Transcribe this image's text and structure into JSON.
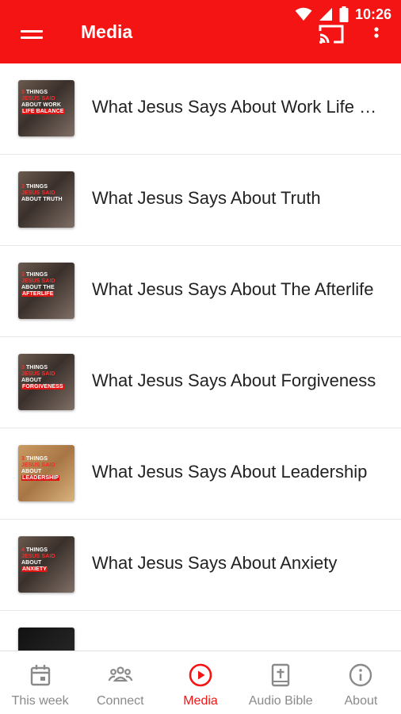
{
  "status_bar": {
    "time": "10:26"
  },
  "app_bar": {
    "title": "Media",
    "menu_icon": "hamburger-menu-icon",
    "cast_icon": "cast-icon",
    "more_icon": "more-vert-icon",
    "accent_color": "#f41414"
  },
  "media_list": [
    {
      "title": "What Jesus Says About Work Life Balance",
      "thumb": {
        "line1_num": "3",
        "line1": " THINGS",
        "line2": "JESUS SAID",
        "line3": "ABOUT WORK",
        "line4": "LIFE BALANCE"
      }
    },
    {
      "title": "What Jesus Says About Truth",
      "thumb": {
        "line1_num": "3",
        "line1": " THINGS",
        "line2": "JESUS SAID",
        "line3": "ABOUT TRUTH",
        "line4": ""
      }
    },
    {
      "title": "What Jesus Says About The Afterlife",
      "thumb": {
        "line1_num": "3",
        "line1": " THINGS",
        "line2": "JESUS SAID",
        "line3": "ABOUT THE",
        "line4": "AFTERLIFE"
      }
    },
    {
      "title": "What Jesus Says About Forgiveness",
      "thumb": {
        "line1_num": "3",
        "line1": " THINGS",
        "line2": "JESUS SAID",
        "line3": "ABOUT",
        "line4": "FORGIVENESS"
      }
    },
    {
      "title": "What Jesus Says About Leadership",
      "thumb": {
        "line1_num": "3",
        "line1": " THINGS",
        "line2": "JESUS SAID",
        "line3": "ABOUT",
        "line4": "LEADERSHIP"
      }
    },
    {
      "title": "What Jesus Says About Anxiety",
      "thumb": {
        "line1_num": "4",
        "line1": " THINGS",
        "line2": "JESUS SAID",
        "line3": "ABOUT",
        "line4": "ANXIETY"
      }
    }
  ],
  "bottom_nav": [
    {
      "label": "This week",
      "icon": "calendar-icon",
      "active": false
    },
    {
      "label": "Connect",
      "icon": "group-icon",
      "active": false
    },
    {
      "label": "Media",
      "icon": "play-circle-icon",
      "active": true
    },
    {
      "label": "Audio Bible",
      "icon": "bible-icon",
      "active": false
    },
    {
      "label": "About",
      "icon": "info-icon",
      "active": false
    }
  ]
}
